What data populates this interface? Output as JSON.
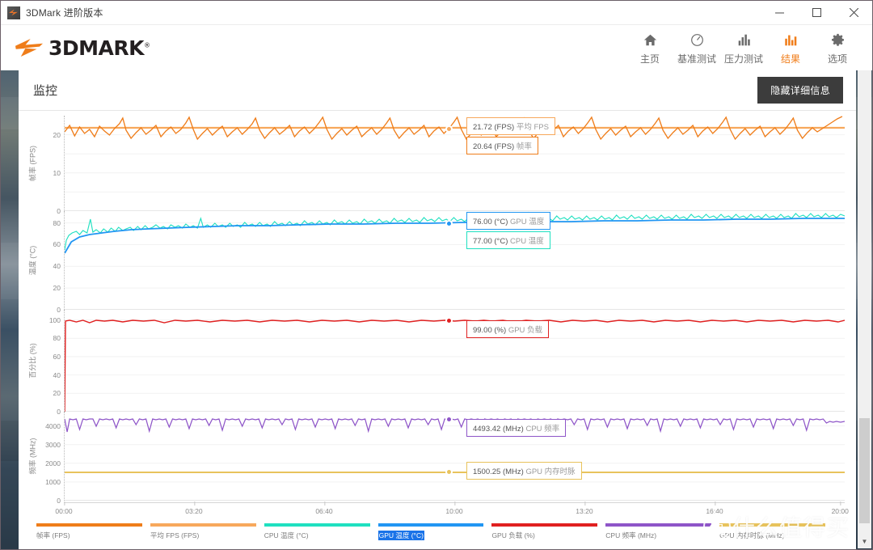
{
  "window": {
    "title": "3DMark 进阶版本",
    "app_icon": "3dmark-app-icon",
    "controls": {
      "minimize": "minimize-icon",
      "maximize": "maximize-icon",
      "close": "close-icon"
    }
  },
  "brand": {
    "wordmark": "3DMARK",
    "registered": "®"
  },
  "nav": {
    "items": [
      {
        "label": "主页",
        "icon": "home-icon",
        "active": false
      },
      {
        "label": "基准测试",
        "icon": "gauge-icon",
        "active": false
      },
      {
        "label": "压力测试",
        "icon": "bar-chart-icon",
        "active": false
      },
      {
        "label": "结果",
        "icon": "bars-icon",
        "active": true
      },
      {
        "label": "选项",
        "icon": "gear-icon",
        "active": false
      }
    ],
    "accent": "#f07d1a"
  },
  "subheader": {
    "page_title": "监控",
    "hide_details_label": "隐藏详细信息"
  },
  "chart_data": [
    {
      "type": "line",
      "title": "帧率",
      "ylabel": "帧率 (FPS)",
      "ylim": [
        0,
        25
      ],
      "yticks": [
        0,
        10,
        20
      ],
      "xlabel": "",
      "grid": true,
      "series": [
        {
          "name": "帧率 (FPS)",
          "color": "#ef7d1a",
          "mean": 20.64
        },
        {
          "name": "平均 FPS (FPS)",
          "color": "#f7a85c",
          "mean": 21.72
        }
      ],
      "annotations": [
        {
          "value": "21.72",
          "unit": "(FPS)",
          "name": "平均 FPS",
          "color": "#f7a85c"
        },
        {
          "value": "20.64",
          "unit": "(FPS)",
          "name": "帧率",
          "color": "#ef7d1a"
        }
      ]
    },
    {
      "type": "line",
      "title": "温度",
      "ylabel": "温度 (°C)",
      "ylim": [
        0,
        90
      ],
      "yticks": [
        0,
        20,
        40,
        60,
        80
      ],
      "grid": true,
      "series": [
        {
          "name": "CPU 温度 (°C)",
          "color": "#1fe0c0",
          "mean": 77.0
        },
        {
          "name": "GPU 温度 (°C)",
          "color": "#2196f3",
          "mean": 76.0
        }
      ],
      "annotations": [
        {
          "value": "76.00",
          "unit": "(°C)",
          "name": "GPU 温度",
          "color": "#2196f3"
        },
        {
          "value": "77.00",
          "unit": "(°C)",
          "name": "CPU 温度",
          "color": "#1fe0c0"
        }
      ]
    },
    {
      "type": "line",
      "title": "百分比",
      "ylabel": "百分比 (%)",
      "ylim": [
        0,
        110
      ],
      "yticks": [
        0,
        20,
        40,
        60,
        80,
        100
      ],
      "grid": true,
      "series": [
        {
          "name": "GPU 负载 (%)",
          "color": "#e02020",
          "mean": 99.0
        }
      ],
      "annotations": [
        {
          "value": "99.00",
          "unit": "(%)",
          "name": "GPU 负载",
          "color": "#e02020"
        }
      ]
    },
    {
      "type": "line",
      "title": "频率",
      "ylabel": "频率 (MHz)",
      "ylim": [
        0,
        4800
      ],
      "yticks": [
        0,
        1000,
        2000,
        3000,
        4000
      ],
      "grid": true,
      "series": [
        {
          "name": "CPU 频率 (MHz)",
          "color": "#8e55c8",
          "mean": 4493.42
        },
        {
          "name": "GPU 内存时脉 (MHz)",
          "color": "#e8c35c",
          "mean": 1500.25
        }
      ],
      "annotations": [
        {
          "value": "4493.42",
          "unit": "(MHz)",
          "name": "CPU 频率",
          "color": "#8e55c8"
        },
        {
          "value": "1500.25",
          "unit": "(MHz)",
          "name": "GPU 内存时脉",
          "color": "#e8c35c"
        }
      ]
    }
  ],
  "xaxis": {
    "ticks": [
      "00:00",
      "03:20",
      "06:40",
      "10:00",
      "13:20",
      "16:40",
      "20:00"
    ],
    "origin_label": "0"
  },
  "legend": {
    "items": [
      {
        "label": "帧率 (FPS)",
        "color": "#ef7d1a",
        "selected": false
      },
      {
        "label": "平均 FPS (FPS)",
        "color": "#f7a85c",
        "selected": false
      },
      {
        "label": "CPU 温度 (°C)",
        "color": "#1fe0c0",
        "selected": false
      },
      {
        "label": "GPU 温度 (°C)",
        "color": "#2196f3",
        "selected": true
      },
      {
        "label": "GPU 负载 (%)",
        "color": "#e02020",
        "selected": false
      },
      {
        "label": "CPU 频率 (MHz)",
        "color": "#8e55c8",
        "selected": false
      },
      {
        "label": "GPU 内存时脉 (MHz)",
        "color": "#e8c35c",
        "selected": false
      }
    ]
  },
  "watermark": {
    "mark": "值",
    "text": "什么值得买"
  }
}
